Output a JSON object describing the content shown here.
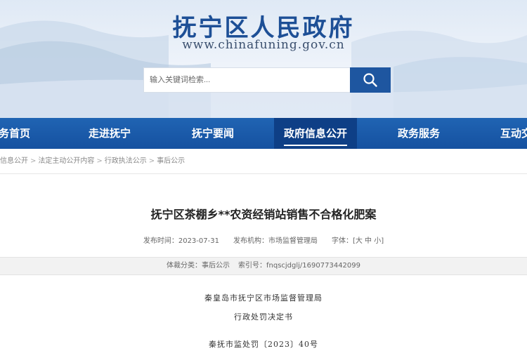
{
  "header": {
    "site_title": "抚宁区人民政府",
    "site_url": "www.chinafuning.gov.cn",
    "search_placeholder": "输入关键词检索...",
    "search_icon": "search-icon",
    "brand_color": "#1e56a0"
  },
  "nav": {
    "items": [
      {
        "label": "务首页"
      },
      {
        "label": "走进抚宁"
      },
      {
        "label": "抚宁要闻"
      },
      {
        "label": "政府信息公开",
        "active": true
      },
      {
        "label": "政务服务"
      },
      {
        "label": "互动交"
      }
    ],
    "bar_color": "#1a5aa8",
    "active_color": "#0e3f86"
  },
  "breadcrumb": {
    "items": [
      "信息公开",
      "法定主动公开内容",
      "行政执法公示",
      "事后公示"
    ]
  },
  "article": {
    "title": "抚宁区茶棚乡**农资经销站销售不合格化肥案",
    "publish_date_label": "发布时间：",
    "publish_date": "2023-07-31",
    "publisher_label": "发布机构：",
    "publisher": "市场监督管理局",
    "font_label": "字体：",
    "font_sizes": "[大 中 小]",
    "category_label": "体裁分类：",
    "category": "事后公示",
    "index_label": "索引号：",
    "index_no": "fnqscjdglj/1690773442099"
  },
  "document": {
    "issuer": "秦皇岛市抚宁区市场监督管理局",
    "doc_type": "行政处罚决定书",
    "doc_no": "秦抚市监处罚〔2023〕40号"
  }
}
